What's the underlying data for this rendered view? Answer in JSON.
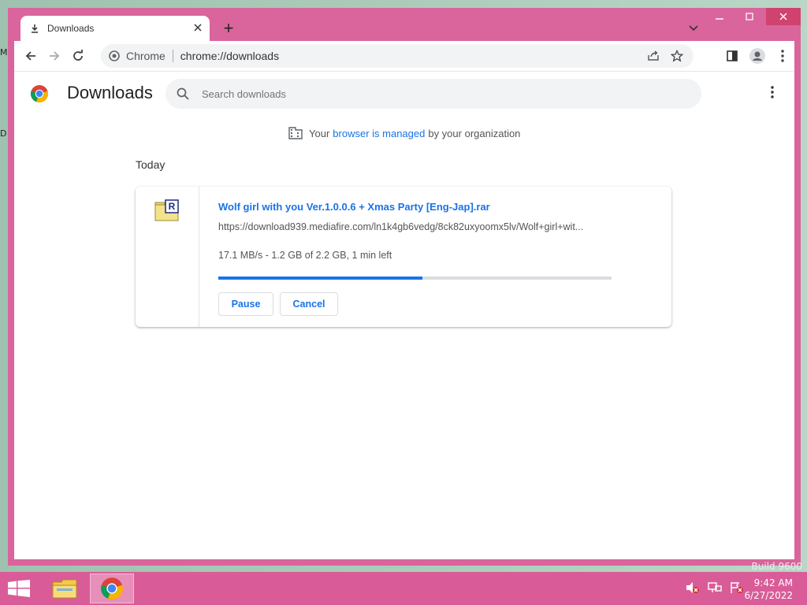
{
  "desktop": {
    "label_top": "M",
    "label_mid": "D",
    "watermark": "Build 9600"
  },
  "window": {
    "controls": [
      "–",
      "☐",
      "✕"
    ]
  },
  "tab": {
    "title": "Downloads",
    "new_tab": "+"
  },
  "omnibox": {
    "site": "Chrome",
    "url": "chrome://downloads"
  },
  "page": {
    "title": "Downloads",
    "search_placeholder": "Search downloads",
    "managed_prefix": "Your",
    "managed_link": "browser is managed",
    "managed_suffix": "by your organization",
    "section": "Today"
  },
  "download": {
    "file_name": "Wolf girl with you Ver.1.0.0.6 + Xmas Party [Eng-Jap].rar",
    "url": "https://download939.mediafire.com/ln1k4gb6vedg/8ck82uxyoomx5lv/Wolf+girl+wit...",
    "status": "17.1 MB/s - 1.2 GB of 2.2 GB, 1 min left",
    "progress": 0.52,
    "pause_label": "Pause",
    "cancel_label": "Cancel",
    "icon_letter": "R"
  },
  "taskbar": {
    "time": "9:42 AM",
    "date": "6/27/2022"
  },
  "colors": {
    "accent": "#1a73e8",
    "frame": "#d9659c",
    "taskbar": "#d95c99"
  }
}
